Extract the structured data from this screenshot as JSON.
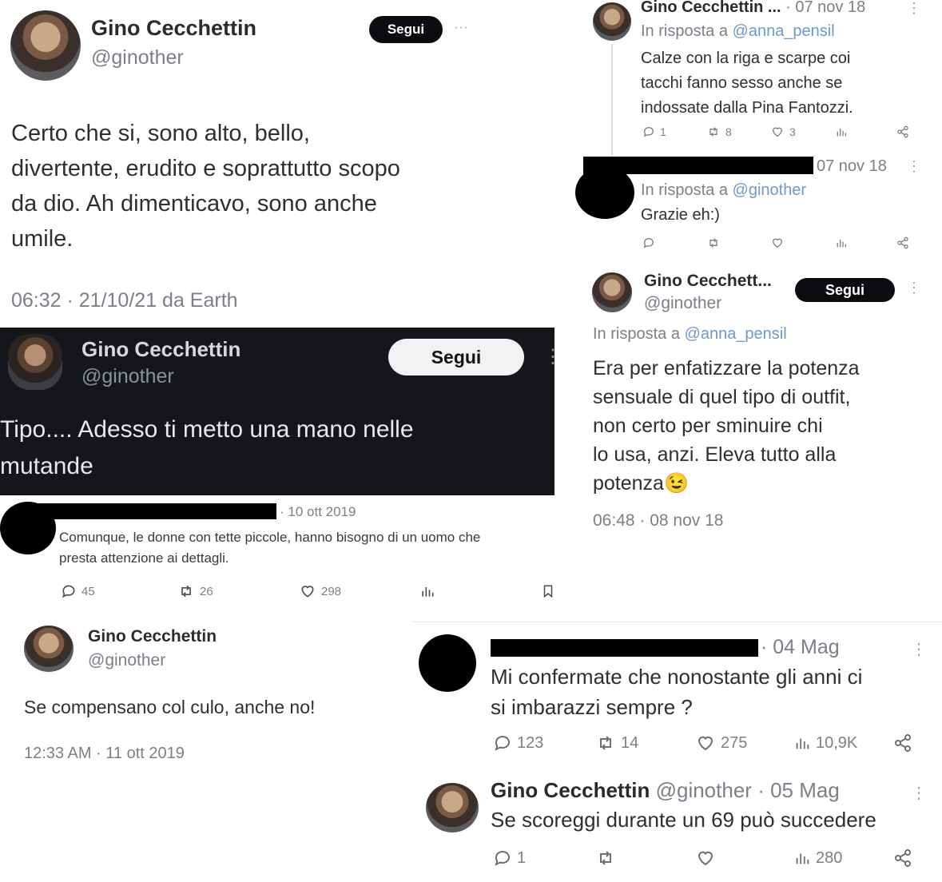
{
  "tweet1": {
    "name": "Gino Cecchettin",
    "handle": "@ginother",
    "follow": "Segui",
    "more": "···",
    "text_lines": [
      "Certo che si, sono alto, bello,",
      "divertente, erudito e soprattutto scopo",
      "da dio. Ah dimenticavo, sono anche",
      "umile."
    ],
    "meta": "06:32 · 21/10/21 da Earth"
  },
  "tweet2": {
    "name": "Gino Cecchettin ...",
    "date": "· 07 nov 18",
    "reply_prefix": "In risposta a",
    "reply_to": "@anna_pensil",
    "text_lines": [
      "Calze con la riga e scarpe coi",
      "tacchi fanno sesso anche se",
      "indossate dalla Pina Fantozzi."
    ],
    "stats": {
      "replies": "1",
      "retweets": "8",
      "likes": "3"
    }
  },
  "tweet3": {
    "date": "07 nov 18",
    "reply_prefix": "In risposta a",
    "reply_to": "@ginother",
    "text": "Grazie eh:)"
  },
  "tweet4": {
    "name": "Gino Cecchett...",
    "handle": "@ginother",
    "follow": "Segui",
    "reply_prefix": "In risposta a",
    "reply_to": "@anna_pensil",
    "text_lines": [
      "Era per enfatizzare la potenza",
      "sensuale di quel tipo di outfit,",
      "non certo per sminuire chi",
      "lo usa, anzi. Eleva tutto alla",
      "potenza"
    ],
    "emoji": "😉",
    "meta": "06:48 · 08 nov 18"
  },
  "tweet5": {
    "name": "Gino Cecchettin",
    "handle": "@ginother",
    "follow": "Segui",
    "text_lines": [
      "Tipo.... Adesso ti metto una mano nelle",
      "mutande"
    ]
  },
  "tweet6": {
    "date": "· 10 ott 2019",
    "text_lines": [
      "Comunque, le donne con tette piccole, hanno bisogno di un uomo che",
      "presta attenzione ai dettagli."
    ],
    "stats": {
      "replies": "45",
      "retweets": "26",
      "likes": "298"
    }
  },
  "tweet7": {
    "name": "Gino Cecchettin",
    "handle": "@ginother",
    "text": "Se compensano col culo, anche no!",
    "meta": "12:33 AM · 11 ott 2019"
  },
  "tweet8": {
    "date": "· 04 Mag",
    "text_lines": [
      "Mi confermate che nonostante gli anni ci",
      "si imbarazzi sempre ?"
    ],
    "stats": {
      "replies": "123",
      "retweets": "14",
      "likes": "275",
      "views": "10,9K"
    }
  },
  "tweet9": {
    "name": "Gino Cecchettin",
    "handle": "@ginother",
    "date": "· 05 Mag",
    "text": "Se scoreggi durante un 69 può succedere",
    "stats": {
      "replies": "1",
      "views": "280"
    }
  },
  "colors": {
    "accent_link": "#6e9ac8",
    "dark_panel": "#15161c",
    "button_dark": "#0c0c10"
  }
}
